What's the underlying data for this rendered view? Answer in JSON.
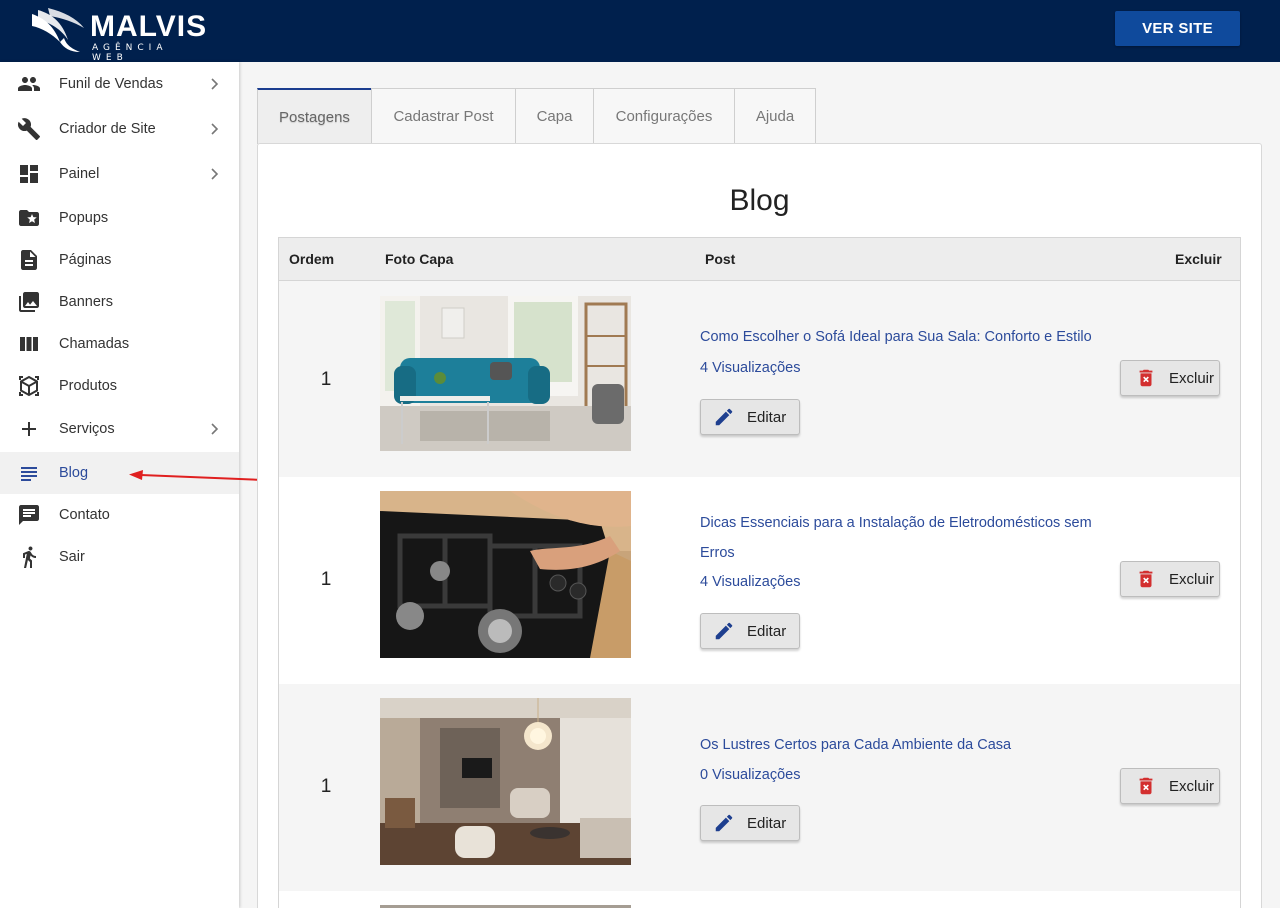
{
  "header": {
    "logo_name": "MALVIS",
    "logo_sub": "AGÊNCIA WEB",
    "ver_site_label": "VER SITE"
  },
  "sidebar": {
    "items": [
      {
        "label": "Funil de Vendas",
        "icon": "people-icon",
        "has_chevron": true
      },
      {
        "label": "Criador de Site",
        "icon": "wrench-icon",
        "has_chevron": true
      },
      {
        "label": "Painel",
        "icon": "dashboard-icon",
        "has_chevron": true
      },
      {
        "label": "Popups",
        "icon": "folder-star-icon",
        "has_chevron": false
      },
      {
        "label": "Páginas",
        "icon": "document-icon",
        "has_chevron": false
      },
      {
        "label": "Banners",
        "icon": "photo-library-icon",
        "has_chevron": false
      },
      {
        "label": "Chamadas",
        "icon": "columns-icon",
        "has_chevron": false
      },
      {
        "label": "Produtos",
        "icon": "box-icon",
        "has_chevron": false
      },
      {
        "label": "Serviços",
        "icon": "plus-icon",
        "has_chevron": true
      },
      {
        "label": "Blog",
        "icon": "lines-icon",
        "has_chevron": false,
        "active": true
      },
      {
        "label": "Contato",
        "icon": "chat-icon",
        "has_chevron": false
      },
      {
        "label": "Sair",
        "icon": "exit-person-icon",
        "has_chevron": false
      }
    ],
    "active_color": "#2c4b9b"
  },
  "tabs": [
    {
      "label": "Postagens",
      "active": true
    },
    {
      "label": "Cadastrar Post",
      "active": false
    },
    {
      "label": "Capa",
      "active": false
    },
    {
      "label": "Configurações",
      "active": false
    },
    {
      "label": "Ajuda",
      "active": false
    }
  ],
  "main": {
    "title": "Blog",
    "columns": {
      "ordem": "Ordem",
      "foto": "Foto Capa",
      "post": "Post",
      "excluir": "Excluir"
    },
    "rows": [
      {
        "ordem": "1",
        "title": "Como Escolher o Sofá Ideal para Sua Sala: Conforto e Estilo",
        "views": "4 Visualizações",
        "edit_label": "Editar",
        "delete_label": "Excluir",
        "image": "teal-sofa-living-room"
      },
      {
        "ordem": "1",
        "title": "Dicas Essenciais para a Instalação de Eletrodomésticos sem Erros",
        "views": "4 Visualizações",
        "edit_label": "Editar",
        "delete_label": "Excluir",
        "image": "gas-cooktop-installation"
      },
      {
        "ordem": "1",
        "title": "Os Lustres Certos para Cada Ambiente da Casa",
        "views": "0 Visualizações",
        "edit_label": "Editar",
        "delete_label": "Excluir",
        "image": "chandelier-living-room"
      }
    ]
  },
  "colors": {
    "header_bg": "#00204d",
    "button_blue": "#0f4a9c",
    "link_blue": "#2c4b9b",
    "delete_red": "#d32f2f",
    "arrow_red": "#e02020"
  }
}
